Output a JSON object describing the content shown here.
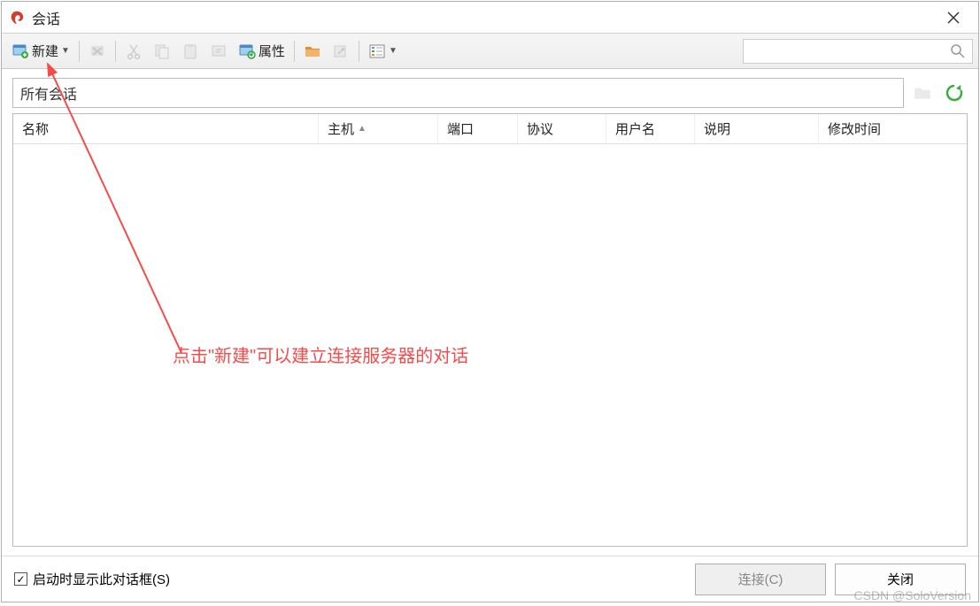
{
  "window": {
    "title": "会话"
  },
  "toolbar": {
    "new_label": "新建",
    "properties_label": "属性"
  },
  "path": {
    "value": "所有会话"
  },
  "table": {
    "columns": {
      "name": "名称",
      "host": "主机",
      "port": "端口",
      "protocol": "协议",
      "username": "用户名",
      "description": "说明",
      "modified": "修改时间"
    },
    "sort_indicator": "▲"
  },
  "bottom": {
    "show_on_startup": "启动时显示此对话框(S)",
    "show_on_startup_checked": true,
    "connect_label": "连接(C)",
    "close_label": "关闭"
  },
  "annotation": {
    "text": "点击\"新建\"可以建立连接服务器的对话"
  },
  "watermark": "CSDN @SoloVersion",
  "colors": {
    "accent_green": "#3bad3f",
    "accent_red": "#f54b4b",
    "icon_orange": "#e78b2f",
    "icon_blue": "#5a9bd5"
  }
}
